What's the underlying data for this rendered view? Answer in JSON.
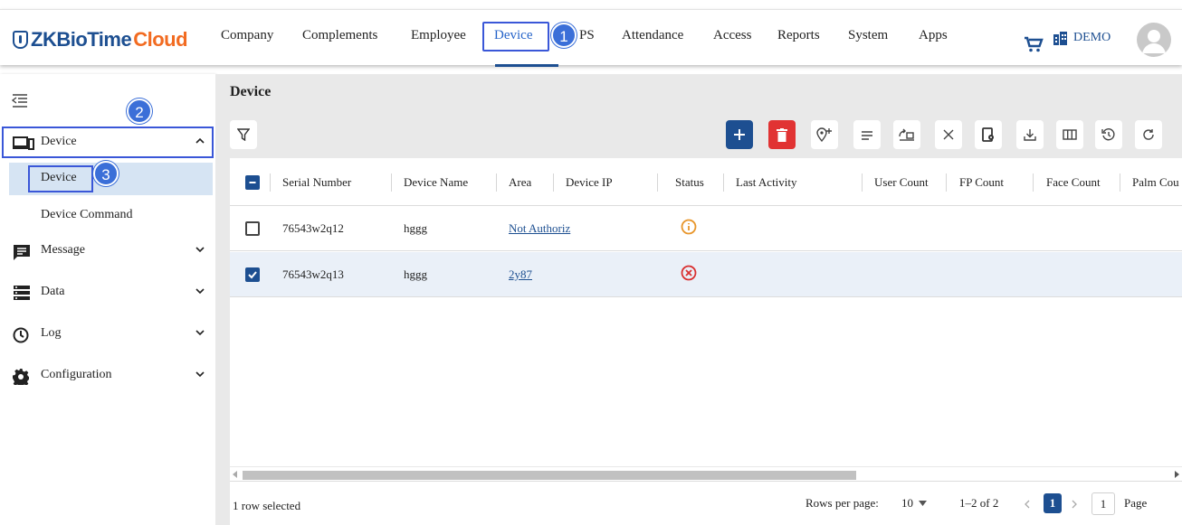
{
  "brand": {
    "prefix": "ZKBioTime",
    "suffix": "Cloud"
  },
  "nav": {
    "items": [
      "Company",
      "Complements",
      "Employee",
      "Device",
      "PS",
      "Attendance",
      "Access",
      "Reports",
      "System",
      "Apps"
    ],
    "active": "Device",
    "account": "DEMO"
  },
  "annotations": [
    "1",
    "2",
    "3"
  ],
  "sidebar": {
    "groups": [
      {
        "label": "Device",
        "expanded": true
      },
      {
        "label": "Message"
      },
      {
        "label": "Data"
      },
      {
        "label": "Log"
      },
      {
        "label": "Configuration"
      }
    ],
    "subitems": [
      "Device",
      "Device Command"
    ],
    "active_sub": "Device"
  },
  "main": {
    "title": "Device",
    "toolbar_icons": [
      "filter-icon",
      "add-icon",
      "delete-icon",
      "location-add-icon",
      "menu-icon",
      "transfer-icon",
      "close-icon",
      "device-setting-icon",
      "download-icon",
      "columns-icon",
      "history-icon",
      "refresh-icon"
    ],
    "columns": [
      "Serial Number",
      "Device Name",
      "Area",
      "Device IP",
      "Status",
      "Last Activity",
      "User Count",
      "FP Count",
      "Face Count",
      "Palm Cou"
    ],
    "rows": [
      {
        "serial": "76543w2q12",
        "name": "hggg",
        "area": "Not Authoriz",
        "ip": "",
        "status": "warning",
        "selected": false
      },
      {
        "serial": "76543w2q13",
        "name": "hggg",
        "area": "2y87",
        "ip": "",
        "status": "error",
        "selected": true
      }
    ],
    "status_colors": {
      "warning": "#e8962b",
      "error": "#d93030"
    },
    "footer": {
      "selected_text": "1 row selected",
      "rows_per_page_label": "Rows per page:",
      "rows_per_page": "10",
      "range": "1–2 of 2",
      "current_page": "1",
      "page_input": "1",
      "page_label": "Page"
    }
  },
  "colors": {
    "primary": "#1d4f91",
    "accent": "#f26b21",
    "annotation": "#3a57d8"
  }
}
